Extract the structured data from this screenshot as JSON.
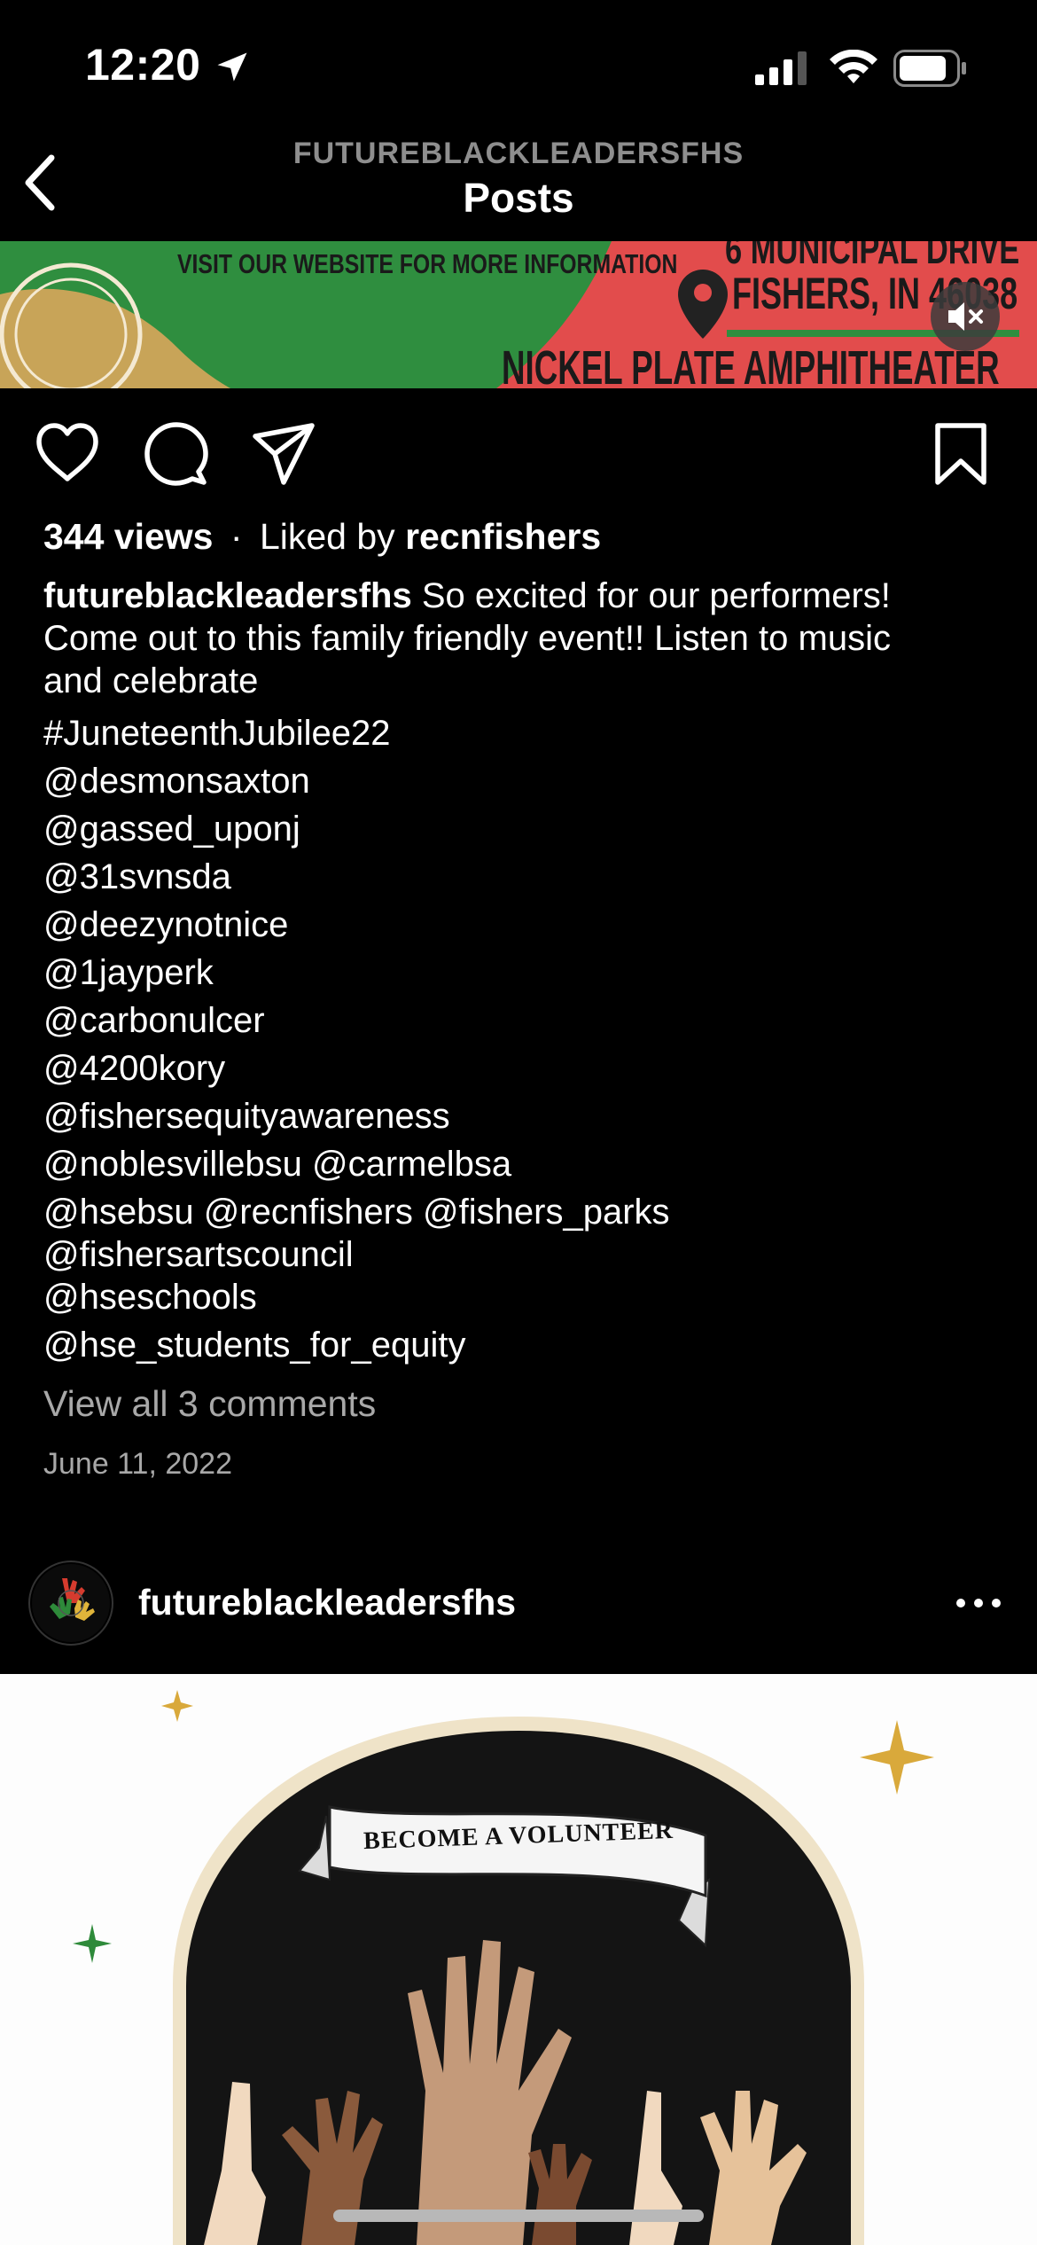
{
  "status_bar": {
    "time": "12:20"
  },
  "header": {
    "account": "FUTUREBLACKLEADERSFHS",
    "title": "Posts"
  },
  "banner": {
    "left_text": "VISIT OUR WEBSITE FOR MORE INFORMATION",
    "address_line1": "6 MUNICIPAL DRIVE",
    "address_line2": "FISHERS, IN 46038",
    "venue": "NICKEL PLATE AMPHITHEATER",
    "colors": {
      "green": "#2e8b3d",
      "red": "#e0464a",
      "tan": "#c9a55a"
    }
  },
  "post": {
    "views": "344 views",
    "dot": "·",
    "liked_by_prefix": "Liked by ",
    "liked_by_user": "recnfishers",
    "author": "futureblackleadersfhs",
    "caption_line1_rest": " So excited for our performers!",
    "caption_line2": "Come out to this family friendly event!! Listen to music",
    "caption_line3": "and celebrate",
    "mentions": [
      "#JuneteenthJubilee22",
      "@desmonsaxton",
      "@gassed_uponj",
      "@31svnsda",
      "@deezynotnice",
      "@1jayperk",
      "@carbonulcer",
      "@4200kory",
      "@fishersequityawareness",
      "@noblesvillebsu @carmelbsa"
    ],
    "mentions_wrapped_line1": "@hsebsu @recnfishers @fishers_parks",
    "mentions_wrapped_line2": "@fishersartscouncil",
    "mentions_tail": [
      "@hseschools",
      "@hse_students_for_equity"
    ],
    "view_comments": "View all 3 comments",
    "date": "June 11, 2022"
  },
  "next_post": {
    "username": "futureblackleadersfhs",
    "image_banner_text": "BECOME A VOLUNTEER"
  },
  "colors": {
    "background": "#000000",
    "muted_text": "#a8a8a8",
    "header_sub": "#8e8e8e"
  }
}
